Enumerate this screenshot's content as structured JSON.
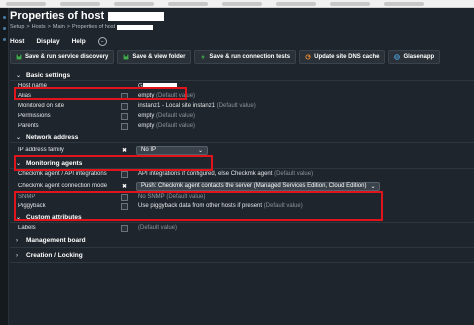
{
  "page": {
    "title": "Properties of host",
    "breadcrumb": [
      "Setup",
      "Hosts",
      "Main",
      "Properties of host"
    ]
  },
  "menu": {
    "items": [
      "Host",
      "Display",
      "Help"
    ]
  },
  "toolbar": {
    "buttons": [
      {
        "label": "Save & run service discovery",
        "icon": "save-icon"
      },
      {
        "label": "Save & view folder",
        "icon": "save-icon"
      },
      {
        "label": "Save & run connection tests",
        "icon": "lightning-icon"
      },
      {
        "label": "Update site DNS cache",
        "icon": "refresh-icon"
      },
      {
        "label": "Glasenapp",
        "icon": "globe-icon"
      }
    ]
  },
  "sections": {
    "basic": {
      "title": "Basic settings",
      "rows": [
        {
          "label": "Host name",
          "value": "G"
        },
        {
          "label": "Alias",
          "value": "empty",
          "note": "(Default value)"
        },
        {
          "label": "Monitored on site",
          "value": "instanz1 - Local site instanz1",
          "note": "(Default value)"
        },
        {
          "label": "Permissions",
          "value": "empty",
          "note": "(Default value)"
        },
        {
          "label": "Parents",
          "value": "empty",
          "note": "(Default value)"
        }
      ]
    },
    "network": {
      "title": "Network address",
      "rows": [
        {
          "label": "IP address family",
          "value": "No IP"
        }
      ]
    },
    "monitoring": {
      "title": "Monitoring agents",
      "rows": [
        {
          "label": "Checkmk agent / API integrations",
          "value": "API integrations if configured, else Checkmk agent",
          "note": "(Default value)"
        },
        {
          "label": "Checkmk agent connection mode",
          "value": "Push: Checkmk agent contacts the server (Managed Services Edition, Cloud Edition)"
        },
        {
          "label": "SNMP",
          "value": "No SNMP",
          "note": "(Default value)"
        },
        {
          "label": "Piggyback",
          "value": "Use piggyback data from other hosts if present",
          "note": "(Default value)"
        }
      ]
    },
    "custom": {
      "title": "Custom attributes",
      "rows": [
        {
          "label": "Labels",
          "value": "",
          "note": "(Default value)"
        }
      ]
    },
    "management": {
      "title": "Management board"
    },
    "creation": {
      "title": "Creation / Locking"
    }
  },
  "colors": {
    "highlight": "#e0141b",
    "background": "#1f252c"
  }
}
